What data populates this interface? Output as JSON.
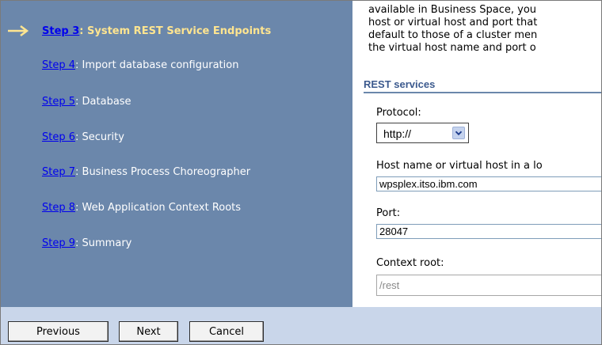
{
  "wizard": {
    "current_step_index": 0,
    "steps": [
      {
        "link": "Step 3",
        "label": ": System REST Service Endpoints"
      },
      {
        "link": "Step 4",
        "label": ": Import database configuration"
      },
      {
        "link": "Step 5",
        "label": ": Database"
      },
      {
        "link": "Step 6",
        "label": ": Security"
      },
      {
        "link": "Step 7",
        "label": ": Business Process Choreographer"
      },
      {
        "link": "Step 8",
        "label": ": Web Application Context Roots"
      },
      {
        "link": "Step 9",
        "label": ": Summary"
      }
    ]
  },
  "main": {
    "intro_lines": [
      "available in Business Space, you",
      "host or virtual host and port that",
      "default to those of a cluster men",
      "the virtual host name and port o"
    ],
    "section_title": "REST services",
    "protocol": {
      "label": "Protocol:",
      "value": "http://"
    },
    "host": {
      "label": "Host name or virtual host in a lo",
      "value": "wpsplex.itso.ibm.com"
    },
    "port": {
      "label": "Port:",
      "value": "28047"
    },
    "context_root": {
      "label": "Context root:",
      "value": "/rest"
    }
  },
  "footer": {
    "previous_label": "Previous",
    "next_label": "Next",
    "cancel_label": "Cancel"
  },
  "colors": {
    "sidebar_bg": "#6b87ab",
    "current_step_text": "#ffe590",
    "link": "#0000ee",
    "section_title": "#3c5a8e",
    "footer_bg": "#c9d6ea"
  },
  "icons": {
    "current_step": "arrow-right-icon",
    "dropdown": "chevron-down-icon"
  }
}
